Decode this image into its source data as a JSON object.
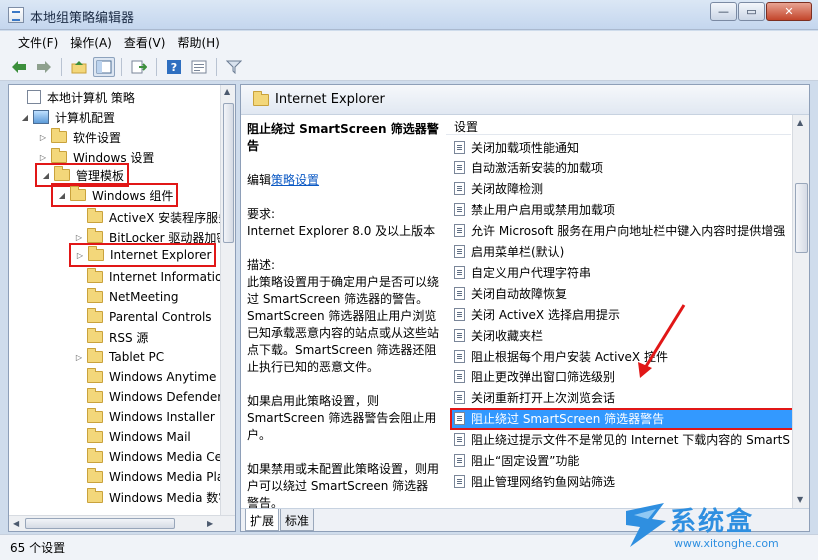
{
  "window": {
    "title": "本地组策略编辑器",
    "controls": [
      "—",
      "▭",
      "✕"
    ]
  },
  "menu": [
    "文件(F)",
    "操作(A)",
    "查看(V)",
    "帮助(H)"
  ],
  "toolbar": {
    "icons": [
      "back-arrow-icon",
      "forward-arrow-icon",
      "up-folder-icon",
      "show-tree-icon",
      "export-icon",
      "help-icon",
      "properties-icon",
      "filter-icon"
    ]
  },
  "tree": {
    "items": [
      {
        "label": "本地计算机 策略",
        "icon": "policy"
      },
      {
        "label": "计算机配置",
        "icon": "computer"
      },
      {
        "label": "软件设置",
        "icon": "folder"
      },
      {
        "label": "Windows 设置",
        "icon": "folder"
      },
      {
        "label": "管理模板",
        "icon": "folder"
      },
      {
        "label": "Windows 组件",
        "icon": "folder"
      },
      {
        "label": "ActiveX 安装程序服务",
        "icon": "folder"
      },
      {
        "label": "BitLocker 驱动器加密",
        "icon": "folder"
      },
      {
        "label": "Internet Explorer",
        "icon": "folder"
      },
      {
        "label": "Internet Information Services",
        "icon": "folder"
      },
      {
        "label": "NetMeeting",
        "icon": "folder"
      },
      {
        "label": "Parental Controls",
        "icon": "folder"
      },
      {
        "label": "RSS 源",
        "icon": "folder"
      },
      {
        "label": "Tablet PC",
        "icon": "folder"
      },
      {
        "label": "Windows Anytime Upgrade",
        "icon": "folder"
      },
      {
        "label": "Windows Defender",
        "icon": "folder"
      },
      {
        "label": "Windows Installer",
        "icon": "folder"
      },
      {
        "label": "Windows Mail",
        "icon": "folder"
      },
      {
        "label": "Windows Media Center",
        "icon": "folder"
      },
      {
        "label": "Windows Media Player",
        "icon": "folder"
      },
      {
        "label": "Windows Media 数字权限管理",
        "icon": "folder"
      }
    ]
  },
  "right": {
    "header": "Internet Explorer",
    "description": {
      "title": "阻止绕过 SmartScreen 筛选器警告",
      "edit_prefix": "编辑",
      "edit_link": "策略设置",
      "requirement_label": "要求:",
      "requirement": "Internet Explorer 8.0 及以上版本",
      "desc_label": "描述:",
      "desc_text": "此策略设置用于确定用户是否可以绕过 SmartScreen 筛选器的警告。SmartScreen 筛选器阻止用户浏览已知承载恶意内容的站点或从这些站点下载。SmartScreen 筛选器还阻止执行已知的恶意文件。",
      "enabled_text": "如果启用此策略设置，则 SmartScreen 筛选器警告会阻止用户。",
      "disabled_text": "如果禁用或未配置此策略设置，则用户可以绕过 SmartScreen 筛选器警告。"
    },
    "list_header": "设置",
    "settings": [
      "关闭加载项性能通知",
      "自动激活新安装的加载项",
      "关闭故障检测",
      "禁止用户启用或禁用加载项",
      "允许 Microsoft 服务在用户向地址栏中键入内容时提供增强",
      "启用菜单栏(默认)",
      "自定义用户代理字符串",
      "关闭自动故障恢复",
      "关闭 ActiveX 选择启用提示",
      "关闭收藏夹栏",
      "阻止根据每个用户安装 ActiveX 控件",
      "阻止更改弹出窗口筛选级别",
      "关闭重新打开上次浏览会话",
      "阻止绕过 SmartScreen 筛选器警告",
      "阻止绕过提示文件不是常见的 Internet 下载内容的 SmartS",
      "阻止“固定设置”功能",
      "阻止管理网络钓鱼网站筛选"
    ],
    "selected_index": 13,
    "tabs": [
      "扩展",
      "标准"
    ]
  },
  "status": "65 个设置",
  "watermark": {
    "brand": "系统盒",
    "url": "www.xitonghe.com"
  },
  "colors": {
    "highlight_red": "#e11717",
    "selection_blue": "#3399ff",
    "link_blue": "#0b59c4"
  }
}
